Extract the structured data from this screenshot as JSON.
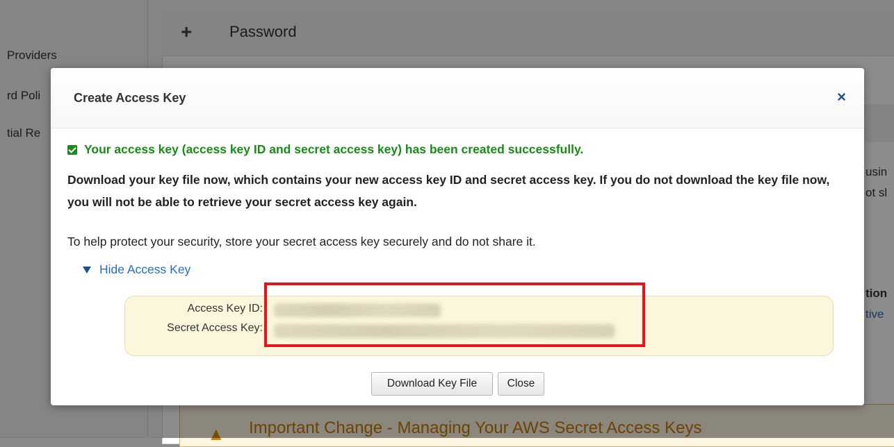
{
  "background": {
    "sidebar_items": [
      "Providers",
      "rd Poli",
      "tial Re"
    ],
    "section_title": "Password",
    "right_fragments": [
      "usin",
      "ot sl",
      "tion",
      "tive"
    ],
    "warning_title": "Important Change - Managing Your AWS Secret Access Keys"
  },
  "modal": {
    "title": "Create Access Key",
    "close_glyph": "×",
    "success_message": "Your access key (access key ID and secret access key) has been created successfully.",
    "download_message": "Download your key file now, which contains your new access key ID and secret access key. If you do not download the key file now, you will not be able to retrieve your secret access key again.",
    "protect_message": "To help protect your security, store your secret access key securely and do not share it.",
    "toggle_label": "Hide Access Key",
    "access_key_id_label": "Access Key ID:",
    "secret_key_label": "Secret Access Key:",
    "download_button": "Download Key File",
    "close_button": "Close"
  },
  "colors": {
    "success": "#1a8a1a",
    "link": "#2a6ebb",
    "highlight": "#e8141b",
    "key_panel": "#fbf6dc"
  }
}
